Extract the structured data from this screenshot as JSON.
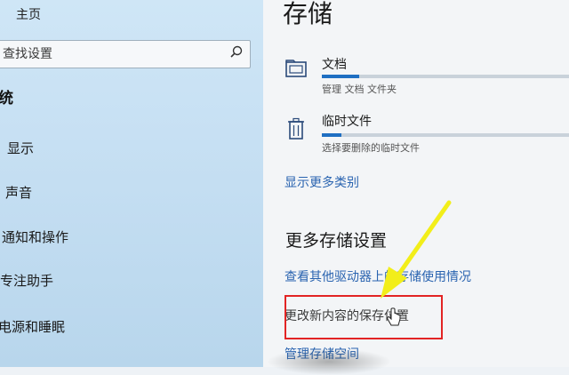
{
  "sidebar": {
    "home_label": "主页",
    "search_placeholder": "查找设置",
    "section_title": "统",
    "items": [
      {
        "label": "显示"
      },
      {
        "label": "声音"
      },
      {
        "label": "通知和操作"
      },
      {
        "label": "专注助手"
      },
      {
        "label": "电源和睡眠"
      }
    ]
  },
  "main": {
    "title": "存储",
    "rows": [
      {
        "name": "文档",
        "desc": "管理 文档 文件夹",
        "usage_fraction": 0.15
      },
      {
        "name": "临时文件",
        "desc": "选择要删除的临时文件",
        "usage_fraction": 0.08
      }
    ],
    "show_more_link": "显示更多类别",
    "more_settings_title": "更多存储设置",
    "links": [
      {
        "label": "查看其他驱动器上的存储使用情况"
      },
      {
        "label": "更改新内容的保存位置"
      },
      {
        "label": "管理存储空间"
      }
    ]
  },
  "colors": {
    "accent": "#1f6fc2",
    "link": "#2a64b0",
    "highlight": "#e22424",
    "arrow": "#f2ee1a"
  }
}
